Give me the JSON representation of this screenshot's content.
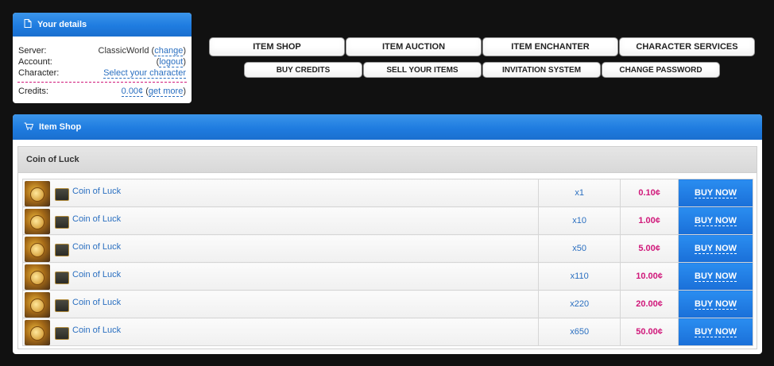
{
  "details": {
    "title": "Your details",
    "server_label": "Server:",
    "server_value": "ClassicWorld",
    "server_change": "change",
    "account_label": "Account:",
    "account_logout": "logout",
    "character_label": "Character:",
    "character_select": "Select your character",
    "credits_label": "Credits:",
    "credits_value": "0.00¢",
    "credits_get_more": "get more"
  },
  "nav_top": [
    "ITEM SHOP",
    "ITEM AUCTION",
    "ITEM ENCHANTER",
    "CHARACTER SERVICES"
  ],
  "nav_bottom": [
    "BUY CREDITS",
    "SELL YOUR ITEMS",
    "INVITATION SYSTEM",
    "CHANGE PASSWORD"
  ],
  "shop": {
    "title": "Item Shop",
    "category": "Coin of Luck",
    "buy_label": "BUY NOW",
    "items": [
      {
        "name": "Coin of Luck",
        "qty": "x1",
        "price": "0.10¢"
      },
      {
        "name": "Coin of Luck",
        "qty": "x10",
        "price": "1.00¢"
      },
      {
        "name": "Coin of Luck",
        "qty": "x50",
        "price": "5.00¢"
      },
      {
        "name": "Coin of Luck",
        "qty": "x110",
        "price": "10.00¢"
      },
      {
        "name": "Coin of Luck",
        "qty": "x220",
        "price": "20.00¢"
      },
      {
        "name": "Coin of Luck",
        "qty": "x650",
        "price": "50.00¢"
      }
    ]
  },
  "colors": {
    "accent": "#1f7ce0",
    "price": "#d0187a",
    "link": "#2a6fc0"
  }
}
